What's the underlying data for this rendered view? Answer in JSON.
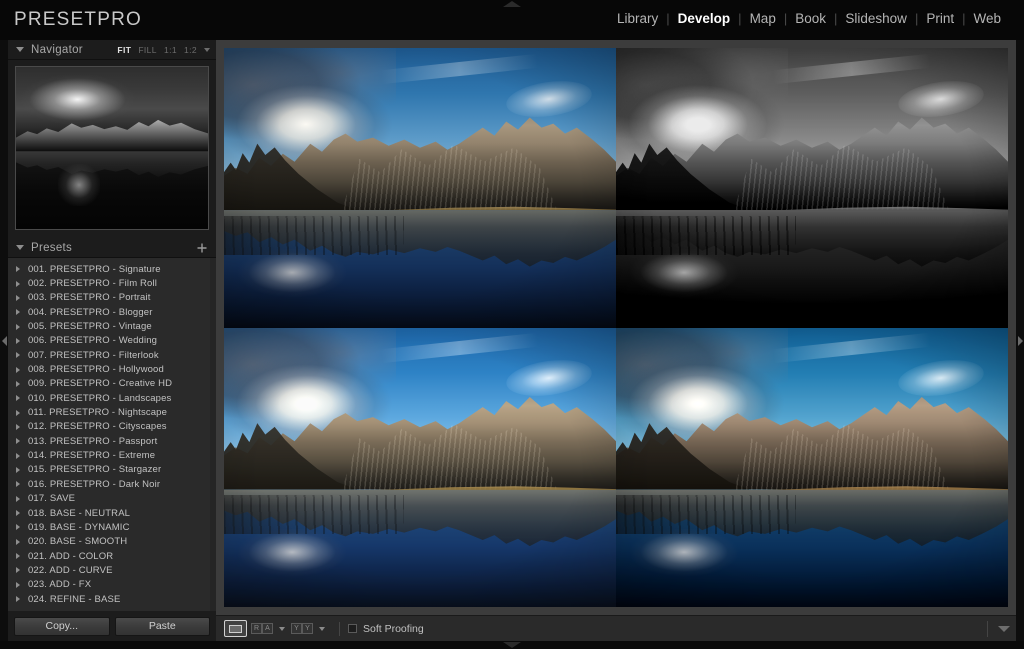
{
  "app": {
    "brand": "PRESETPRO"
  },
  "modules": {
    "items": [
      {
        "label": "Library",
        "active": false
      },
      {
        "label": "Develop",
        "active": true
      },
      {
        "label": "Map",
        "active": false
      },
      {
        "label": "Book",
        "active": false
      },
      {
        "label": "Slideshow",
        "active": false
      },
      {
        "label": "Print",
        "active": false
      },
      {
        "label": "Web",
        "active": false
      }
    ],
    "separator": "|"
  },
  "navigator": {
    "title": "Navigator",
    "zoom_levels": [
      {
        "label": "FIT",
        "active": true
      },
      {
        "label": "FILL",
        "active": false
      },
      {
        "label": "1:1",
        "active": false
      },
      {
        "label": "1:2",
        "active": false
      }
    ]
  },
  "presets": {
    "title": "Presets",
    "add_icon": "plus-icon",
    "items": [
      "001. PRESETPRO - Signature",
      "002. PRESETPRO - Film Roll",
      "003. PRESETPRO - Portrait",
      "004. PRESETPRO - Blogger",
      "005. PRESETPRO - Vintage",
      "006. PRESETPRO - Wedding",
      "007. PRESETPRO - Filterlook",
      "008. PRESETPRO - Hollywood",
      "009. PRESETPRO - Creative HD",
      "010. PRESETPRO - Landscapes",
      "011. PRESETPRO - Nightscape",
      "012. PRESETPRO - Cityscapes",
      "013. PRESETPRO - Passport",
      "014. PRESETPRO - Extreme",
      "015. PRESETPRO - Stargazer",
      "016. PRESETPRO - Dark Noir",
      "017. SAVE",
      "018. BASE - NEUTRAL",
      "019. BASE - DYNAMIC",
      "020. BASE - SMOOTH",
      "021. ADD - COLOR",
      "022. ADD - CURVE",
      "023. ADD - FX",
      "024. REFINE - BASE"
    ]
  },
  "left_bottom": {
    "copy_label": "Copy...",
    "paste_label": "Paste"
  },
  "toolbar": {
    "loupe_icon": "loupe-view-icon",
    "before_after_left": "R",
    "before_after_right": "A",
    "compare_left": "Y",
    "compare_right": "Y",
    "soft_proofing_label": "Soft Proofing",
    "soft_proofing_checked": false,
    "right_chevron_icon": "chevron-down-icon"
  },
  "preview": {
    "cells": [
      {
        "name": "original-color",
        "variant": "base"
      },
      {
        "name": "black-and-white",
        "variant": "bw"
      },
      {
        "name": "warm-bright",
        "variant": "warm"
      },
      {
        "name": "cool-teal",
        "variant": "cool"
      }
    ]
  },
  "colors": {
    "panel_bg": "#1c1c1c",
    "presets_bg": "#2a2a2a",
    "center_bg": "#3c3c3c",
    "toolbar_bg": "#2a2a2a",
    "text": "#c2c2c2",
    "active_text": "#ffffff"
  }
}
